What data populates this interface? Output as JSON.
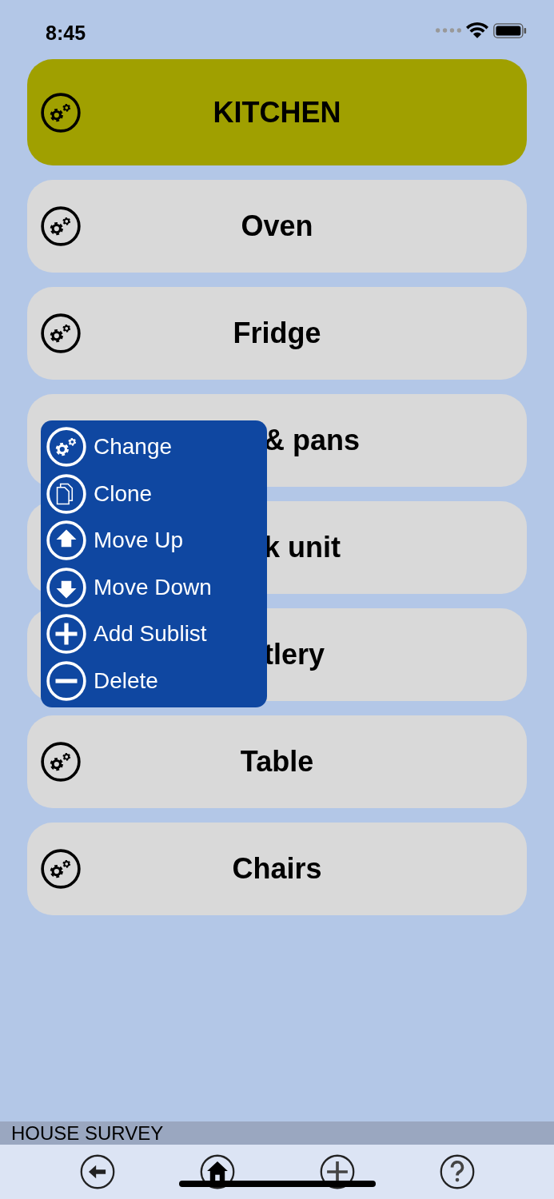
{
  "status_bar": {
    "time": "8:45"
  },
  "list": {
    "header": {
      "label": "KITCHEN"
    },
    "items": [
      {
        "label": "Oven",
        "kind": "full"
      },
      {
        "label": "Fridge",
        "kind": "full"
      },
      {
        "label": "& pans",
        "kind": "covered"
      },
      {
        "label": "k unit",
        "kind": "covered"
      },
      {
        "label": "tlery",
        "kind": "covered"
      },
      {
        "label": "Table",
        "kind": "full"
      },
      {
        "label": "Chairs",
        "kind": "full"
      }
    ]
  },
  "context_menu": {
    "items": [
      {
        "label": "Change",
        "kind": "gears"
      },
      {
        "label": "Clone",
        "kind": "copy"
      },
      {
        "label": "Move Up",
        "kind": "up"
      },
      {
        "label": "Move Down",
        "kind": "down"
      },
      {
        "label": "Add Sublist",
        "kind": "add"
      },
      {
        "label": "Delete",
        "kind": "remove"
      }
    ]
  },
  "footer": {
    "title": "HOUSE SURVEY"
  },
  "toolbar": {
    "buttons": [
      {
        "kind": "back"
      },
      {
        "kind": "home"
      },
      {
        "kind": "add"
      },
      {
        "kind": "help"
      }
    ]
  }
}
